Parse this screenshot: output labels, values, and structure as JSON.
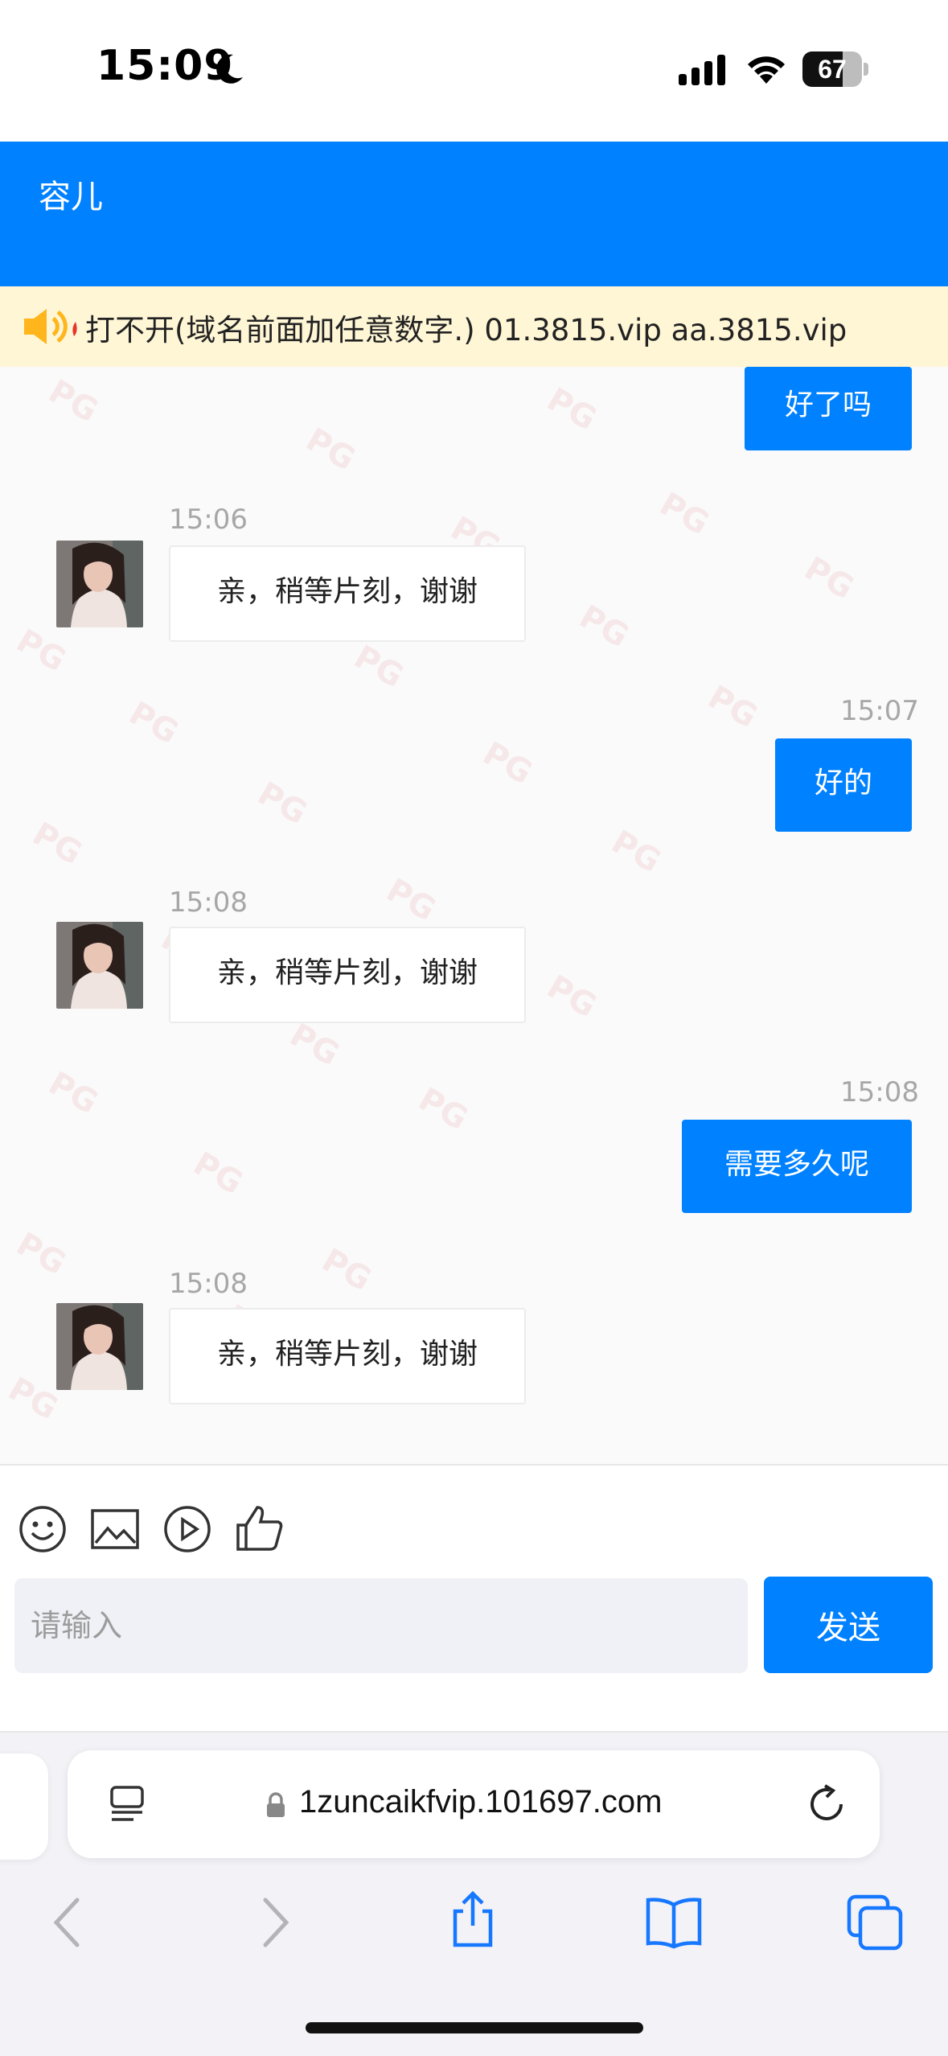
{
  "status_bar": {
    "time": "15:09",
    "battery": "67",
    "battery_level": 0.67
  },
  "header": {
    "title": "容儿"
  },
  "notice": {
    "text": "打不开(域名前面加任意数字.) 01.3815.vip aa.3815.vip"
  },
  "messages": [
    {
      "side": "out",
      "text": "好了吗"
    },
    {
      "side": "in",
      "time": "15:06",
      "text": "亲，稍等片刻，谢谢"
    },
    {
      "side": "out",
      "time": "15:07",
      "text": "好的"
    },
    {
      "side": "in",
      "time": "15:08",
      "text": "亲，稍等片刻，谢谢"
    },
    {
      "side": "out",
      "time": "15:08",
      "text": "需要多久呢"
    },
    {
      "side": "in",
      "time": "15:08",
      "text": "亲，稍等片刻，谢谢"
    }
  ],
  "input": {
    "placeholder": "请输入",
    "send_label": "发送"
  },
  "toolbar": {
    "icons": [
      "emoji-icon",
      "image-icon",
      "video-icon",
      "thumbs-up-icon"
    ]
  },
  "browser": {
    "url": "1zuncaikfvip.101697.com"
  },
  "colors": {
    "accent": "#0081ff",
    "notice_bg": "#fff6d6"
  }
}
